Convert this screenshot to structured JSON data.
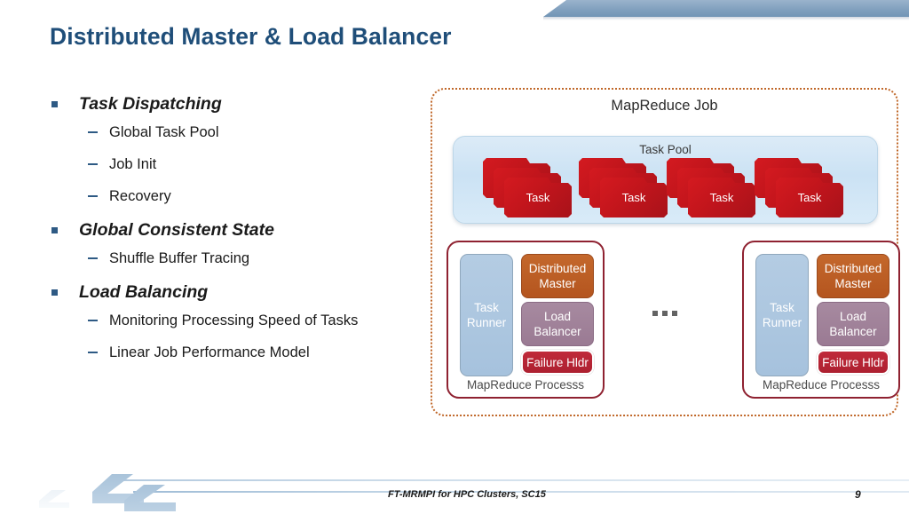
{
  "slide": {
    "title": "Distributed Master & Load Balancer",
    "page_number": "9",
    "footer_text": "FT-MRMPI for HPC Clusters, SC15",
    "title_color": "#1f4e79"
  },
  "bullets": [
    {
      "heading": "Task Dispatching",
      "sub": [
        "Global Task Pool",
        "Job Init",
        "Recovery"
      ]
    },
    {
      "heading": "Global Consistent State",
      "sub": [
        "Shuffle Buffer Tracing"
      ]
    },
    {
      "heading": "Load Balancing",
      "sub": [
        "Monitoring Processing Speed of Tasks",
        "Linear Job Performance Model"
      ]
    }
  ],
  "diagram": {
    "title": "MapReduce Job",
    "border_color": "#c0682a",
    "task_pool": {
      "title": "Task Pool",
      "fill_color": "#cbe2f4",
      "stacks": [
        {
          "label": "Task",
          "cards": 3
        },
        {
          "label": "Task",
          "cards": 3
        },
        {
          "label": "Task",
          "cards": 3
        },
        {
          "label": "Task",
          "cards": 3
        }
      ]
    },
    "ellipsis": "...",
    "processes": [
      {
        "label": "MapReduce Processs",
        "task_runner": "Task Runner",
        "roles": [
          {
            "name": "Distributed Master",
            "color": "#b4551f"
          },
          {
            "name": "Load Balancer",
            "color": "#9a7a93"
          },
          {
            "name": "Failure Hldr",
            "color": "#ad2030"
          }
        ]
      },
      {
        "label": "MapReduce Processs",
        "task_runner": "Task Runner",
        "roles": [
          {
            "name": "Distributed Master",
            "color": "#b4551f"
          },
          {
            "name": "Load Balancer",
            "color": "#9a7a93"
          },
          {
            "name": "Failure Hldr",
            "color": "#ad2030"
          }
        ]
      }
    ]
  }
}
